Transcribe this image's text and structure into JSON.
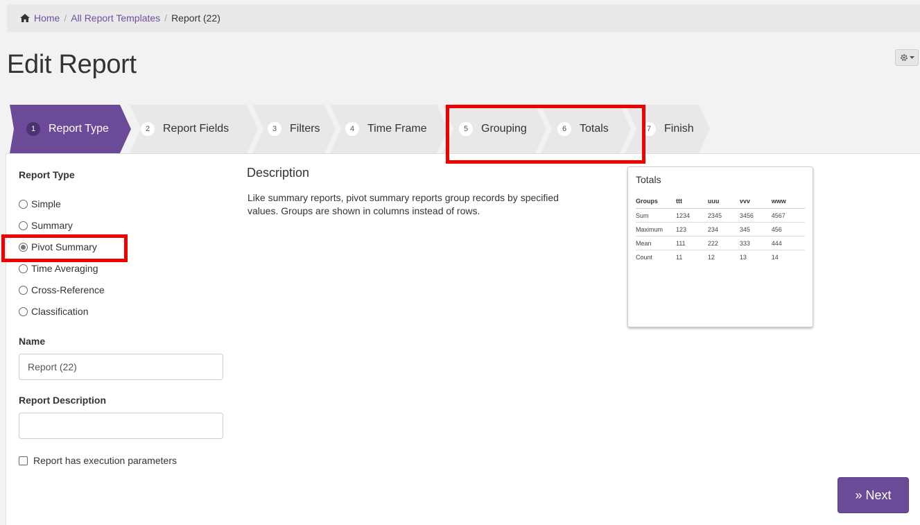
{
  "breadcrumb": {
    "home": "Home",
    "templates": "All Report Templates",
    "current": "Report (22)",
    "separator": "/"
  },
  "page_title": "Edit Report",
  "wizard": {
    "steps": [
      {
        "num": "1",
        "label": "Report Type",
        "active": true
      },
      {
        "num": "2",
        "label": "Report Fields"
      },
      {
        "num": "3",
        "label": "Filters"
      },
      {
        "num": "4",
        "label": "Time Frame"
      },
      {
        "num": "5",
        "label": "Grouping"
      },
      {
        "num": "6",
        "label": "Totals"
      },
      {
        "num": "7",
        "label": "Finish"
      }
    ]
  },
  "report_type": {
    "heading": "Report Type",
    "options": [
      "Simple",
      "Summary",
      "Pivot Summary",
      "Time Averaging",
      "Cross-Reference",
      "Classification"
    ],
    "selected": "Pivot Summary"
  },
  "name": {
    "label": "Name",
    "value": "Report (22)"
  },
  "report_description": {
    "label": "Report Description",
    "value": ""
  },
  "execution_params": {
    "label": "Report has execution parameters",
    "checked": false
  },
  "description": {
    "heading": "Description",
    "text": "Like summary reports, pivot summary reports group records by specified values. Groups are shown in columns instead of rows."
  },
  "preview": {
    "title": "Totals",
    "columns": [
      "Groups",
      "ttt",
      "uuu",
      "vvv",
      "www"
    ],
    "rows": [
      [
        "Sum",
        "1234",
        "2345",
        "3456",
        "4567"
      ],
      [
        "Maximum",
        "123",
        "234",
        "345",
        "456"
      ],
      [
        "Mean",
        "111",
        "222",
        "333",
        "444"
      ],
      [
        "Count",
        "11",
        "12",
        "13",
        "14"
      ]
    ]
  },
  "next_button": "» Next",
  "colors": {
    "accent": "#6b4b98",
    "highlight": "#ee0000",
    "link": "#6e4fa0"
  }
}
